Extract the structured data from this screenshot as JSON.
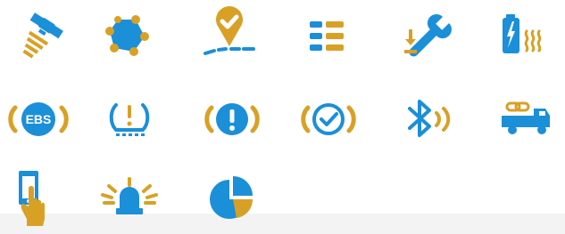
{
  "colors": {
    "blue": "#1b8fd8",
    "gold": "#d8a126",
    "white": "#ffffff",
    "band": "#f3f3f3"
  },
  "icons": [
    {
      "name": "satellite-icon"
    },
    {
      "name": "geofence-polygon-icon"
    },
    {
      "name": "route-checkpoint-icon"
    },
    {
      "name": "list-icon"
    },
    {
      "name": "wrench-download-icon"
    },
    {
      "name": "battery-heat-icon"
    },
    {
      "name": "ebs-warning-icon"
    },
    {
      "name": "tire-pressure-warning-icon"
    },
    {
      "name": "exclamation-alert-icon"
    },
    {
      "name": "check-alert-icon"
    },
    {
      "name": "bluetooth-icon"
    },
    {
      "name": "truck-trailer-link-icon"
    },
    {
      "name": "touchscreen-hand-icon"
    },
    {
      "name": "beacon-light-icon"
    },
    {
      "name": "pie-chart-icon"
    }
  ],
  "labels": {
    "ebs": "EBS"
  }
}
